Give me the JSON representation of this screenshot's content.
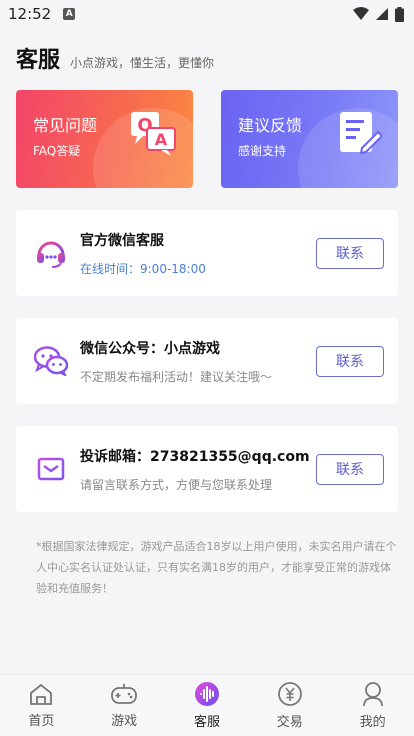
{
  "status_bar": {
    "time": "12:52",
    "notification_badge": "A"
  },
  "header": {
    "title": "客服",
    "subtitle": "小点游戏，懂生活，更懂你"
  },
  "quick_cards": [
    {
      "title": "常见问题",
      "subtitle": "FAQ答疑",
      "icon": "qa-icon"
    },
    {
      "title": "建议反馈",
      "subtitle": "感谢支持",
      "icon": "document-edit-icon"
    }
  ],
  "contacts": [
    {
      "title": "官方微信客服",
      "desc": "在线时间：9:00-18:00",
      "button": "联系",
      "icon": "headset-icon"
    },
    {
      "title": "微信公众号：小点游戏",
      "desc": "不定期发布福利活动！建议关注哦～",
      "button": "联系",
      "icon": "wechat-icon"
    },
    {
      "title": "投诉邮箱：273821355@qq.com",
      "desc": "请留言联系方式，方便与您联系处理",
      "button": "联系",
      "icon": "mail-icon"
    }
  ],
  "notice": "*根据国家法律规定，游戏产品适合18岁以上用户使用，未实名用户请在个人中心实名认证处认证，只有实名满18岁的用户，才能享受正常的游戏体验和充值服务！",
  "nav": [
    {
      "label": "首页",
      "icon": "home-icon"
    },
    {
      "label": "游戏",
      "icon": "gamepad-icon"
    },
    {
      "label": "客服",
      "icon": "service-icon",
      "active": true
    },
    {
      "label": "交易",
      "icon": "yen-icon"
    },
    {
      "label": "我的",
      "icon": "user-icon"
    }
  ],
  "colors": {
    "accent": "#5b5fc7",
    "faq_card": "#f3446a",
    "feedback_card": "#6a63f2",
    "active_nav": "#8a3cf0"
  }
}
